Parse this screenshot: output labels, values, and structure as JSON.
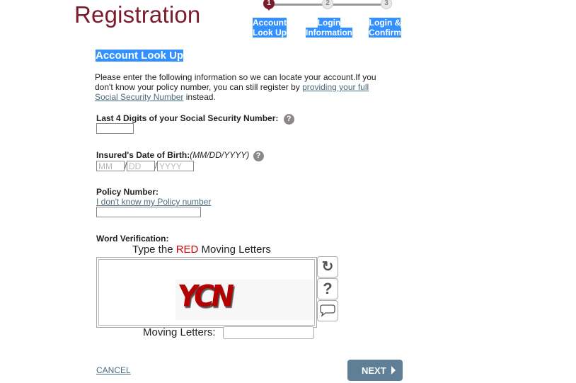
{
  "header": {
    "title": "Registration"
  },
  "steps": [
    {
      "number": "1",
      "label_line1": "Account",
      "label_line2": "Look Up",
      "active": true
    },
    {
      "number": "2",
      "label_line1": "Login",
      "label_line2": "Information",
      "active": false
    },
    {
      "number": "3",
      "label_line1": "Login &",
      "label_line2": "Confirm",
      "active": false
    }
  ],
  "section": {
    "title": "Account Look Up",
    "intro_text": "Please enter the following information so we can locate your account.If you don't know your policy number, you can still register by ",
    "intro_link": "providing your full Social Security Number",
    "intro_suffix": " instead."
  },
  "fields": {
    "ssn": {
      "label": "Last 4 Digits of your Social Security Number:",
      "help": "?",
      "value": ""
    },
    "dob": {
      "label": "Insured's Date of Birth:",
      "format_hint": "(MM/DD/YYYY)",
      "help": "?",
      "month_placeholder": "MM",
      "day_placeholder": "DD",
      "year_placeholder": "YYYY",
      "separator": "/"
    },
    "policy": {
      "label": "Policy Number:",
      "link": "I don't know my Policy number",
      "value": ""
    }
  },
  "captcha": {
    "label": "Word Verification:",
    "instruction_prefix": "Type the ",
    "instruction_highlight": "RED",
    "instruction_suffix": " Moving Letters",
    "image_text": "YCN",
    "refresh_icon": "↻",
    "help_icon": "?",
    "audio_icon": "speech-bubble",
    "input_label": "Moving Letters:",
    "input_value": "",
    "highlight_color": "#cc0000"
  },
  "footer": {
    "cancel_label": "CANCEL",
    "next_label": "NEXT"
  },
  "colors": {
    "brand": "#7b1c2c",
    "button": "#5f7f97",
    "link": "#4a6b80",
    "selection": "#3390ff"
  }
}
